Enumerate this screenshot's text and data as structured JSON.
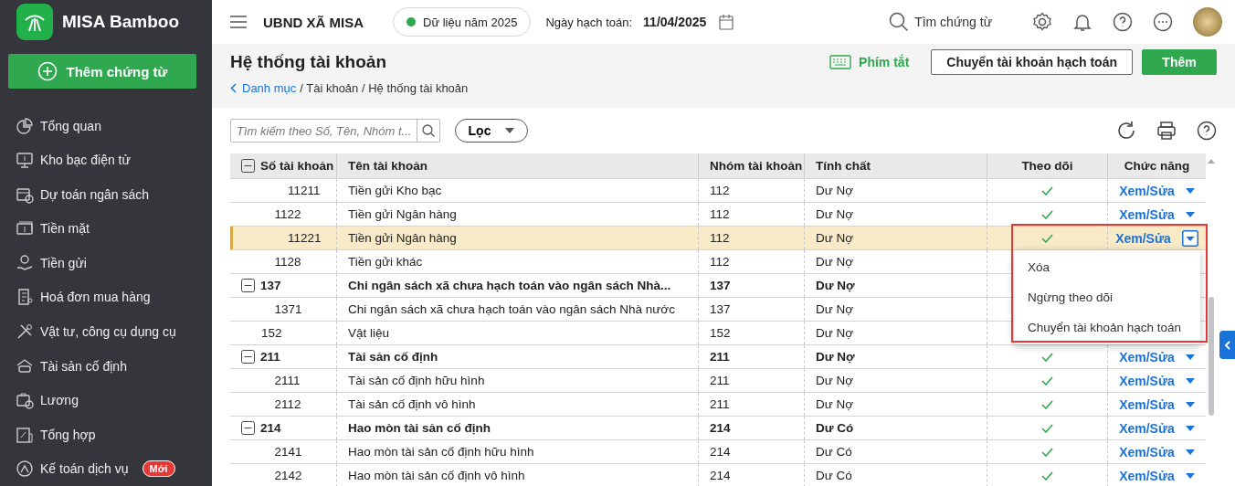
{
  "sidebar": {
    "app_name": "MISA Bamboo",
    "new_button": "Thêm chứng từ",
    "items": [
      {
        "label": "Tổng quan"
      },
      {
        "label": "Kho bạc điện tử"
      },
      {
        "label": "Dự toán ngân sách"
      },
      {
        "label": "Tiền mặt"
      },
      {
        "label": "Tiền gửi"
      },
      {
        "label": "Hoá đơn mua hàng"
      },
      {
        "label": "Vật tư, công cụ dụng cụ"
      },
      {
        "label": "Tài sản cố định"
      },
      {
        "label": "Lương"
      },
      {
        "label": "Tổng hợp"
      },
      {
        "label": "Kế toán dịch vụ",
        "badge": "Mới"
      }
    ]
  },
  "header": {
    "unit": "UBND XÃ MISA",
    "data_year": "Dữ liệu năm 2025",
    "date_label": "Ngày hạch toán:",
    "date": "11/04/2025",
    "search": "Tìm chứng từ"
  },
  "page": {
    "title": "Hệ thống tài khoản",
    "breadcrumb_link": "Danh mục",
    "breadcrumb_rest": "/ Tài khoản / Hệ thống tài khoản",
    "shortcut": "Phím tắt",
    "buttons": [
      "Chuyển tài khoản hạch toán",
      "Thêm"
    ]
  },
  "toolbar": {
    "search_placeholder": "Tìm kiếm theo Số, Tên, Nhóm t...",
    "filter": "Lọc"
  },
  "table": {
    "columns": [
      {
        "label": "Số tài khoản",
        "expanded": true
      },
      {
        "label": "Tên tài khoản"
      },
      {
        "label": "Nhóm tài khoản"
      },
      {
        "label": "Tính chất"
      },
      {
        "label": "Theo dõi"
      },
      {
        "label": "Chức năng"
      }
    ],
    "rows": [
      {
        "children": [
          {
            "children": [
              {
                "number": "11211",
                "name": "Tiền gửi Kho bạc",
                "group": "112",
                "nature": "Dư Nợ",
                "followed": true,
                "action": "Xem/Sửa",
                "selected": false
              }
            ]
          },
          {
            "number": "1122",
            "name": "Tiền gửi Ngân hàng",
            "group": "112",
            "nature": "Dư Nợ",
            "followed": true,
            "action": "Xem/Sửa",
            "selected": false,
            "children": [
              {
                "number": "11221",
                "name": "Tiền gửi Ngân hàng",
                "group": "112",
                "nature": "Dư Nợ",
                "followed": true,
                "action": "Xem/Sửa",
                "selected": true,
                "menu": [
                  "Xóa",
                  "Ngừng theo dõi",
                  "Chuyển tài khoản hạch toán"
                ]
              }
            ]
          },
          {
            "number": "1128",
            "name": "Tiền gửi khác",
            "group": "112",
            "nature": "Dư Nợ",
            "selected": false
          }
        ]
      },
      {
        "number": "137",
        "name": "Chi ngân sách xã chưa hạch toán vào ngân sách Nhà...",
        "group": "137",
        "nature": "Dư Nợ",
        "expanded": true,
        "selected": false,
        "children": [
          {
            "number": "1371",
            "name": "Chi ngân sách xã chưa hạch toán vào ngân sách Nhà nước",
            "group": "137",
            "nature": "Dư Nợ",
            "selected": false
          }
        ]
      },
      {
        "number": "152",
        "name": "Vật liệu",
        "group": "152",
        "nature": "Dư Nợ",
        "selected": false
      },
      {
        "number": "211",
        "name": "Tài sản cố định",
        "group": "211",
        "nature": "Dư Nợ",
        "expanded": true,
        "followed": true,
        "action": "Xem/Sửa",
        "selected": false,
        "children": [
          {
            "number": "2111",
            "name": "Tài sản cố định hữu hình",
            "group": "211",
            "nature": "Dư Nợ",
            "followed": true,
            "action": "Xem/Sửa",
            "selected": false
          },
          {
            "number": "2112",
            "name": "Tài sản cố định vô hình",
            "group": "211",
            "nature": "Dư Nợ",
            "followed": true,
            "action": "Xem/Sửa",
            "selected": false
          }
        ]
      },
      {
        "number": "214",
        "name": "Hao mòn tài sản cố định",
        "group": "214",
        "nature": "Dư Có",
        "expanded": true,
        "followed": true,
        "action": "Xem/Sửa",
        "selected": false,
        "children": [
          {
            "number": "2141",
            "name": "Hao mòn tài sản cố định hữu hình",
            "group": "214",
            "nature": "Dư Có",
            "followed": true,
            "action": "Xem/Sửa",
            "selected": false
          },
          {
            "number": "2142",
            "name": "Hao mòn tài sản cố định vô hình",
            "group": "214",
            "nature": "Dư Có",
            "followed": true,
            "action": "Xem/Sửa",
            "selected": false
          }
        ]
      }
    ]
  }
}
